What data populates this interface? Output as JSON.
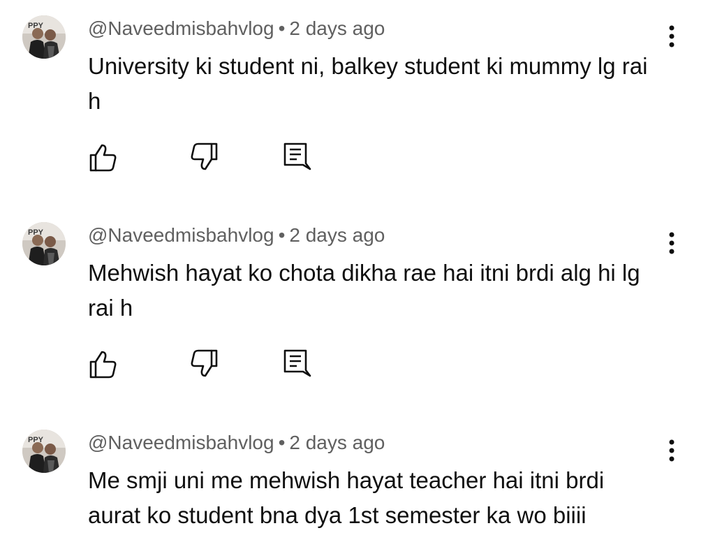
{
  "comments": [
    {
      "author": "@Naveedmisbahvlog",
      "separator": "•",
      "time": "2 days ago",
      "text": "University ki student ni, balkey student ki mummy lg rai h",
      "avatar_badge": "PPY"
    },
    {
      "author": "@Naveedmisbahvlog",
      "separator": "•",
      "time": "2 days ago",
      "text": "Mehwish hayat ko chota dikha rae hai itni brdi alg hi lg rai h",
      "avatar_badge": "PPY"
    },
    {
      "author": "@Naveedmisbahvlog",
      "separator": "•",
      "time": "2 days ago",
      "text": "Me smji uni me mehwish hayat teacher hai itni brdi aurat ko student bna dya 1st semester ka wo biiii",
      "avatar_badge": "PPY"
    }
  ],
  "icons": {
    "like": "thumbs-up-icon",
    "dislike": "thumbs-down-icon",
    "reply": "comment-reply-icon",
    "more": "more-vertical-icon"
  },
  "colors": {
    "meta_text": "#606060",
    "body_text": "#0f0f0f",
    "icon": "#0f0f0f"
  }
}
